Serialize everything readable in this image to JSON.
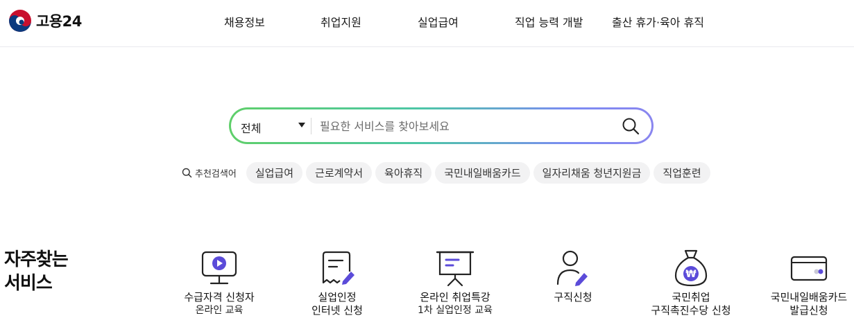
{
  "header": {
    "logo_text": "고용24",
    "nav": [
      "채용정보",
      "취업지원",
      "실업급여",
      "직업 능력 개발",
      "출산 휴가·육아 휴직"
    ]
  },
  "search": {
    "category": "전체",
    "placeholder": "필요한 서비스를 찾아보세요",
    "value": ""
  },
  "recommended": {
    "label": "추천검색어",
    "chips": [
      "실업급여",
      "근로계약서",
      "육아휴직",
      "국민내일배움카드",
      "일자리채움 청년지원금",
      "직업훈련"
    ]
  },
  "frequent": {
    "title_line1": "자주찾는",
    "title_line2": "서비스",
    "items": [
      {
        "icon": "video-monitor-icon",
        "line1": "수급자격 신청자",
        "line2": "온라인 교육"
      },
      {
        "icon": "document-pen-icon",
        "line1": "실업인정",
        "line2": "인터넷 신청"
      },
      {
        "icon": "presentation-board-icon",
        "line1": "온라인 취업특강",
        "line2": "1차 실업인정 교육"
      },
      {
        "icon": "person-pen-icon",
        "line1": "구직신청",
        "line2": ""
      },
      {
        "icon": "money-bag-icon",
        "line1": "국민취업",
        "line2": "구직촉진수당 신청"
      },
      {
        "icon": "card-icon",
        "line1": "국민내일배움카드",
        "line2": "발급신청"
      }
    ]
  },
  "colors": {
    "accent_purple": "#5b4bd9",
    "gradient_green": "#5fcf6a",
    "gradient_blue": "#7b8bf2"
  }
}
